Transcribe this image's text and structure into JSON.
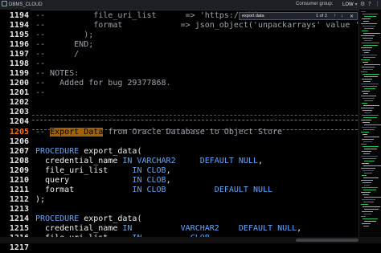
{
  "topbar": {
    "db_label": "DBMS_CLOUD",
    "consumer_group_label": "Consumer group:",
    "consumer_group_value": "LOW"
  },
  "find": {
    "query": "export data",
    "result": "1 of 3",
    "prev": "↑",
    "next": "↓",
    "close": "✕"
  },
  "lines": [
    {
      "num": "1194",
      "parts": [
        {
          "t": "--          file_uri_list      => 'https://object",
          "c": "cm"
        }
      ]
    },
    {
      "num": "1194",
      "parts": [
        {
          "t": "--          format            => json_object('unpackarrays' value 'true')",
          "c": "cm"
        }
      ]
    },
    {
      "num": "1195",
      "parts": [
        {
          "t": "--        );",
          "c": "cm"
        }
      ]
    },
    {
      "num": "1196",
      "parts": [
        {
          "t": "--      END;",
          "c": "cm"
        }
      ]
    },
    {
      "num": "1197",
      "parts": [
        {
          "t": "--      /",
          "c": "cm"
        }
      ]
    },
    {
      "num": "1198",
      "parts": [
        {
          "t": "--",
          "c": "cm"
        }
      ]
    },
    {
      "num": "1199",
      "parts": [
        {
          "t": "-- NOTES:",
          "c": "cm"
        }
      ]
    },
    {
      "num": "1200",
      "parts": [
        {
          "t": "--   Added for bug 29377868.",
          "c": "cm"
        }
      ]
    },
    {
      "num": "1201",
      "parts": [
        {
          "t": "--",
          "c": "cm"
        }
      ]
    },
    {
      "num": "1202",
      "parts": [
        {
          "t": "",
          "c": "cm"
        }
      ]
    },
    {
      "num": "1203",
      "parts": [
        {
          "t": "",
          "c": "cm"
        }
      ]
    },
    {
      "num": "1204",
      "parts": [
        {
          "t": "",
          "c": "cm"
        }
      ]
    },
    {
      "num": "1205",
      "parts": [
        {
          "t": "-- ",
          "c": "cm"
        },
        {
          "t": "Export Data",
          "c": "hl"
        },
        {
          "t": " from Oracle Database to Object Store",
          "c": "cm"
        }
      ]
    },
    {
      "num": "1206",
      "parts": [
        {
          "t": "",
          "c": "cm"
        }
      ]
    },
    {
      "num": "1207",
      "parts": [
        {
          "t": "PROCEDURE ",
          "c": "kw"
        },
        {
          "t": "export_data(",
          "c": "str"
        }
      ]
    },
    {
      "num": "1208",
      "parts": [
        {
          "t": "  credential_name ",
          "c": "str"
        },
        {
          "t": "IN VARCHAR2",
          "c": "kw"
        },
        {
          "t": "     ",
          "c": "str"
        },
        {
          "t": "DEFAULT NULL",
          "c": "kw"
        },
        {
          "t": ",",
          "c": "str"
        }
      ]
    },
    {
      "num": "1209",
      "parts": [
        {
          "t": "  file_uri_list     ",
          "c": "str"
        },
        {
          "t": "IN CLOB",
          "c": "kw"
        },
        {
          "t": ",",
          "c": "str"
        }
      ]
    },
    {
      "num": "1210",
      "parts": [
        {
          "t": "  query             ",
          "c": "str"
        },
        {
          "t": "IN CLOB",
          "c": "kw"
        },
        {
          "t": ",",
          "c": "str"
        }
      ]
    },
    {
      "num": "1211",
      "parts": [
        {
          "t": "  format            ",
          "c": "str"
        },
        {
          "t": "IN CLOB",
          "c": "kw"
        },
        {
          "t": "          ",
          "c": "str"
        },
        {
          "t": "DEFAULT NULL",
          "c": "kw"
        }
      ]
    },
    {
      "num": "1212",
      "parts": [
        {
          "t": ");",
          "c": "str"
        }
      ]
    },
    {
      "num": "1213",
      "parts": [
        {
          "t": "",
          "c": "str"
        }
      ]
    },
    {
      "num": "1214",
      "parts": [
        {
          "t": "PROCEDURE ",
          "c": "kw"
        },
        {
          "t": "export_data(",
          "c": "str"
        }
      ]
    },
    {
      "num": "1215",
      "parts": [
        {
          "t": "  credential_name ",
          "c": "str"
        },
        {
          "t": "IN",
          "c": "kw"
        },
        {
          "t": "          ",
          "c": "str"
        },
        {
          "t": "VARCHAR2",
          "c": "kw"
        },
        {
          "t": "    ",
          "c": "str"
        },
        {
          "t": "DEFAULT NULL",
          "c": "kw"
        },
        {
          "t": ",",
          "c": "str"
        }
      ]
    },
    {
      "num": "1216",
      "parts": [
        {
          "t": "  file_uri_list     ",
          "c": "str"
        },
        {
          "t": "IN",
          "c": "kw"
        },
        {
          "t": "          ",
          "c": "str"
        },
        {
          "t": "CLOB",
          "c": "kw"
        },
        {
          "t": ",",
          "c": "str"
        }
      ]
    },
    {
      "num": "1217",
      "parts": [
        {
          "t": "  query             ",
          "c": "str"
        },
        {
          "t": "IN",
          "c": "kw"
        },
        {
          "t": "          ",
          "c": "str"
        },
        {
          "t": "CLOB",
          "c": "kw"
        },
        {
          "t": ",",
          "c": "str"
        }
      ]
    }
  ],
  "current_line": "1205",
  "colors": {
    "accent": "#f97316",
    "keyword": "#60a5fa",
    "comment": "#9ca3af",
    "highlight": "#a16207"
  }
}
